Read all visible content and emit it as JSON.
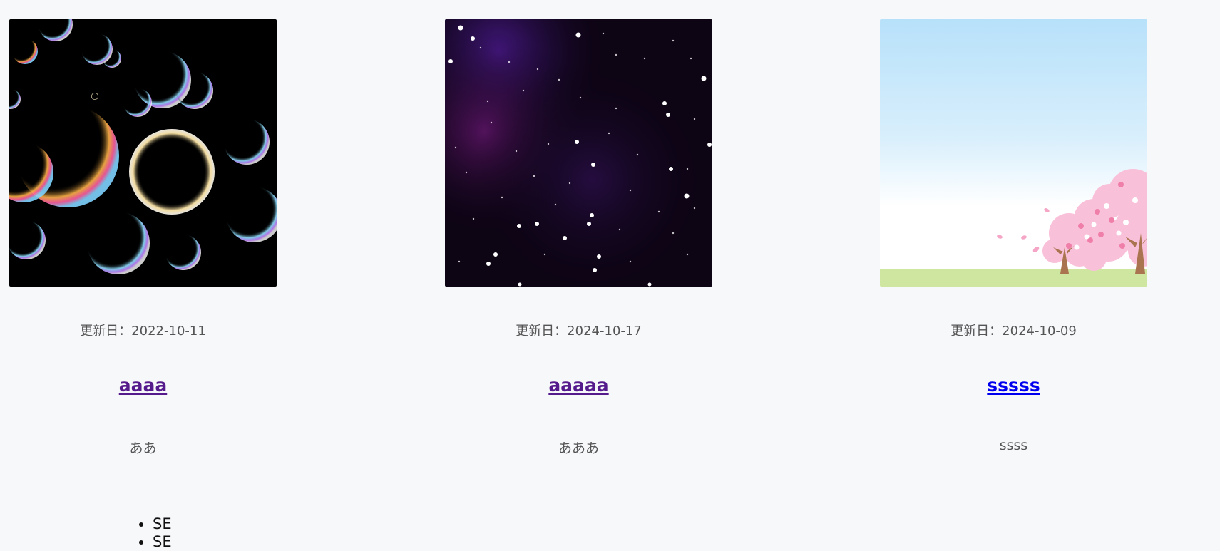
{
  "cards": [
    {
      "image": "soap-bubbles-image",
      "date": "更新日：2022-10-11",
      "title": "aaaa",
      "title_state": "visited",
      "description": "ああ",
      "tags": [
        "SE",
        "SE"
      ]
    },
    {
      "image": "night-starry-sky-image",
      "date": "更新日：2024-10-17",
      "title": "aaaaa",
      "title_state": "visited",
      "description": "あああ"
    },
    {
      "image": "cherry-blossom-tree-image",
      "date": "更新日：2024-10-09",
      "title": "sssss",
      "title_state": "unvisited",
      "description": "ssss"
    }
  ],
  "colors": {
    "page_background": "#f7f8fa",
    "visited_link": "#551a8b",
    "unvisited_link": "#0000ee",
    "meta_text": "#555555"
  }
}
